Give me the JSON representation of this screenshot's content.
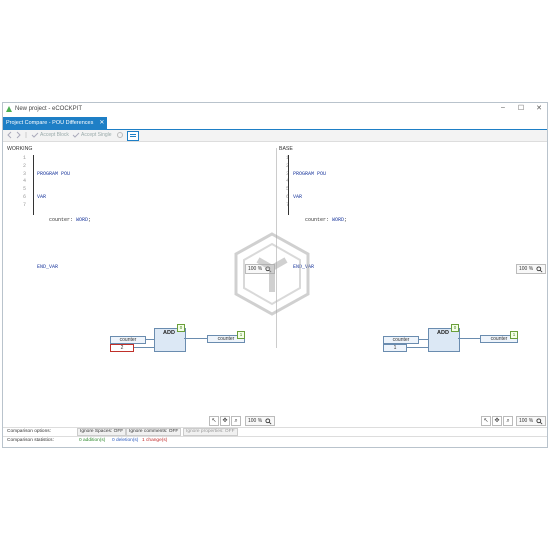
{
  "window": {
    "title": "New project - eCOCKPIT",
    "controls": [
      "–",
      "☐",
      "✕"
    ]
  },
  "tab": {
    "label": "Project Compare - POU Differences",
    "close": "✕"
  },
  "toolbar": {
    "accept_block": "Accept Block",
    "accept_single": "Accept Single"
  },
  "panels": {
    "working": {
      "label": "WORKING",
      "line_numbers": [
        "1",
        "2",
        "3",
        "4",
        "5",
        "6",
        "7"
      ],
      "zoom": "100 %"
    },
    "base": {
      "label": "BASE",
      "line_numbers": [
        "1",
        "2",
        "3",
        "4",
        "5",
        "6",
        "7"
      ],
      "zoom": "100 %"
    }
  },
  "code": {
    "l1_kw": "PROGRAM POU",
    "l2_kw": "VAR",
    "l3_name": "counter: ",
    "l3_type": "WORD",
    "l3_end": ";",
    "l5_kw": "END_VAR"
  },
  "fbd": {
    "working": {
      "block": "ADD",
      "badge_block": "0",
      "badge_out": "1",
      "in1": "counter",
      "in2": "2",
      "out": "counter",
      "zoom": "100 %"
    },
    "base": {
      "block": "ADD",
      "badge_block": "0",
      "badge_out": "1",
      "in1": "counter",
      "in2": "1",
      "out": "counter",
      "zoom": "100 %"
    }
  },
  "status": {
    "options_label": "Comparison options:",
    "ignore_spaces": "Ignore Spaces: OFF",
    "ignore_comments": "Ignore comments: OFF",
    "ignore_properties": "Ignore properties: OFF",
    "stats_label": "Comparison statistics:",
    "additions": "0 addition(s)",
    "deletions": "0 deletion(s)",
    "changes": "1 change(s)"
  },
  "colors": {
    "accent": "#1e7fc6",
    "changed": "#c0302a",
    "added": "#2f8a2f",
    "deleted": "#2b5bbf"
  },
  "icons": [
    "app-icon",
    "back-icon",
    "forward-icon",
    "accept-block-icon",
    "accept-single-icon",
    "toggle-view-icon",
    "zoom-icon",
    "pointer-icon",
    "pan-icon",
    "watermark-logo"
  ]
}
